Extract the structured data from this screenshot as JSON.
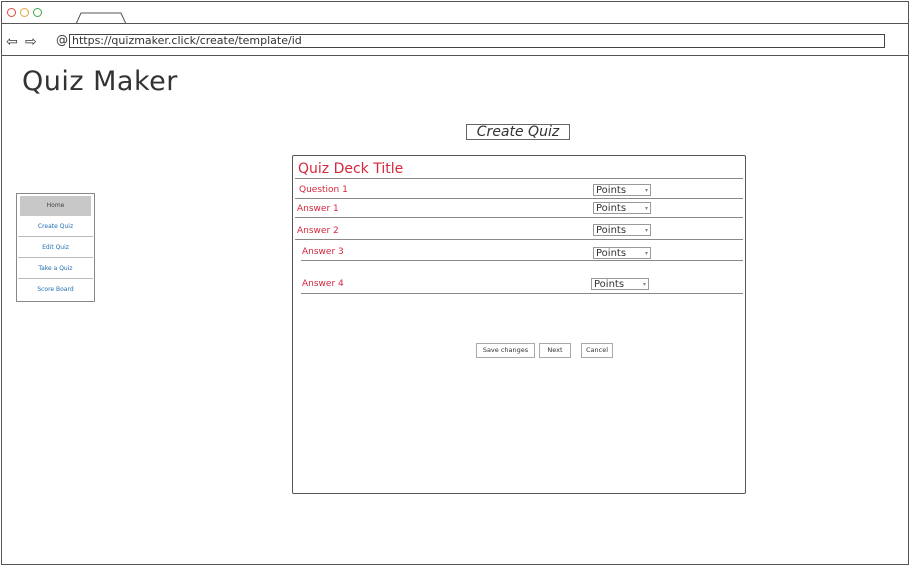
{
  "browser": {
    "url": "https://quizmaker.click/create/template/id",
    "dot_colors": [
      "#e04a3f",
      "#e8a33c",
      "#3da84a"
    ]
  },
  "app": {
    "title": "Quiz Maker"
  },
  "page": {
    "heading": "Create Quiz"
  },
  "sidebar": {
    "items": [
      {
        "label": "Home",
        "active": true
      },
      {
        "label": "Create Quiz"
      },
      {
        "label": "Edit Quiz"
      },
      {
        "label": "Take a Quiz"
      },
      {
        "label": "Score Board"
      }
    ]
  },
  "quiz": {
    "deck_title": "Quiz Deck Title",
    "rows": [
      {
        "label": "Question 1",
        "points": "Points"
      },
      {
        "label": "Answer 1",
        "points": "Points"
      },
      {
        "label": "Answer 2",
        "points": "Points"
      },
      {
        "label": "Answer 3",
        "points": "Points"
      },
      {
        "label": "Answer 4",
        "points": "Points"
      }
    ]
  },
  "actions": {
    "save": "Save changes",
    "next": "Next",
    "cancel": "Cancel"
  },
  "colors": {
    "accent_red": "#d4273c",
    "link_blue": "#1e6eb4"
  }
}
